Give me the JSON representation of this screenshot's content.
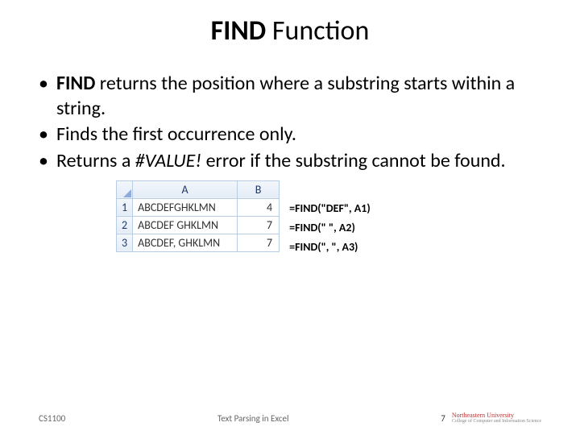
{
  "title": {
    "bold": "FIND",
    "rest": " Function"
  },
  "bullets": [
    {
      "pre_bold": "FIND",
      "rest": " returns the position where a substring starts within a string."
    },
    {
      "text": "Finds the first occurrence only."
    },
    {
      "pre": "Returns a ",
      "italic": "#VALUE!",
      "rest": " error if the substring cannot be found."
    }
  ],
  "excel": {
    "headers": {
      "A": "A",
      "B": "B"
    },
    "rows": [
      {
        "n": "1",
        "A": "ABCDEFGHKLMN",
        "B": "4"
      },
      {
        "n": "2",
        "A": "ABCDEF GHKLMN",
        "B": "7"
      },
      {
        "n": "3",
        "A": "ABCDEF, GHKLMN",
        "B": "7"
      }
    ]
  },
  "formulas": [
    "=FIND(\"DEF\", A1)",
    "=FIND(\" \", A2)",
    "=FIND(\", \", A3)"
  ],
  "footer": {
    "left": "CS1100",
    "center": "Text Parsing in Excel",
    "page": "7",
    "logo_main": "Northeastern University",
    "logo_sub": "College of Computer and Information Science"
  }
}
